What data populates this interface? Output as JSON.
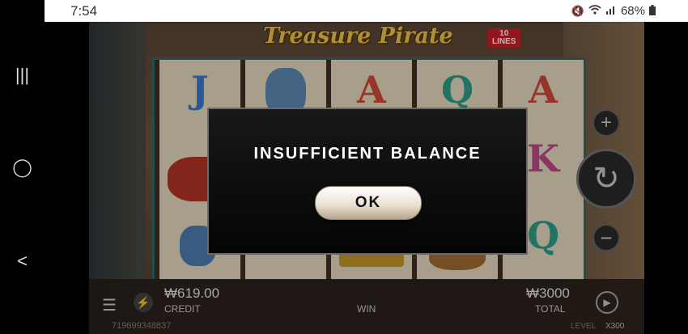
{
  "status_bar": {
    "time": "7:54",
    "battery": "68%",
    "icons": [
      "mute-icon",
      "wifi-icon",
      "signal-icon",
      "battery-icon"
    ]
  },
  "nav_bar": {
    "recents": "|||",
    "home": "◯",
    "back": "<"
  },
  "game": {
    "logo": "Treasure Pirate",
    "lines_badge": "10\nLINES",
    "reels": [
      [
        "J",
        "",
        ""
      ],
      [
        "",
        "",
        ""
      ],
      [
        "A",
        "",
        ""
      ],
      [
        "Q",
        "",
        ""
      ],
      [
        "A",
        "K",
        "Q"
      ]
    ],
    "bottom": {
      "credit_value": "₩619.00",
      "credit_label": "CREDIT",
      "win_label": "WIN",
      "total_value": "₩3000",
      "total_label": "TOTAL",
      "session_id": "719699348837",
      "level_label": "LEVEL",
      "level_value": "X300"
    }
  },
  "dialog": {
    "title": "INSUFFICIENT BALANCE",
    "ok_label": "OK"
  },
  "colors": {
    "dialog_bg": "#0b0b0b",
    "ok_button": "#f2ebe0",
    "logo_gold": "#f2c64a",
    "reel_frame": "#2f6a6c"
  }
}
